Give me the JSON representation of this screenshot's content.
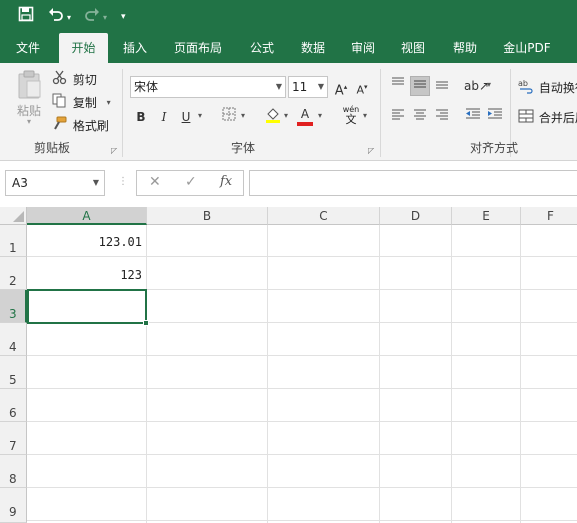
{
  "qat": {
    "save_icon": "save-icon",
    "undo_icon": "undo-icon",
    "redo_icon": "redo-icon",
    "customize_icon": "customize-qat-icon"
  },
  "tabs": [
    {
      "label": "文件"
    },
    {
      "label": "开始"
    },
    {
      "label": "插入"
    },
    {
      "label": "页面布局"
    },
    {
      "label": "公式"
    },
    {
      "label": "数据"
    },
    {
      "label": "审阅"
    },
    {
      "label": "视图"
    },
    {
      "label": "帮助"
    },
    {
      "label": "金山PDF"
    }
  ],
  "ribbon": {
    "clipboard": {
      "paste_label": "粘贴",
      "cut_label": "剪切",
      "copy_label": "复制",
      "format_painter_label": "格式刷",
      "group_label": "剪贴板"
    },
    "font": {
      "font_name": "宋体",
      "font_size": "11",
      "grow_label": "A",
      "shrink_label": "A",
      "bold_label": "B",
      "italic_label": "I",
      "underline_label": "U",
      "font_color_label": "A",
      "phonetic_label": "wén",
      "phonetic_sub": "文",
      "group_label": "字体"
    },
    "alignment": {
      "wrap_text_label": "自动换行",
      "merge_label": "合并后居中",
      "group_label": "对齐方式"
    }
  },
  "formula_bar": {
    "name_box": "A3",
    "fx_label": "fx",
    "cancel_icon": "✕",
    "enter_icon": "✓",
    "formula": ""
  },
  "grid": {
    "columns": [
      "A",
      "B",
      "C",
      "D",
      "E",
      "F"
    ],
    "rows": [
      "1",
      "2",
      "3",
      "4",
      "5",
      "6",
      "7",
      "8",
      "9"
    ],
    "cells": {
      "A1": "123.01",
      "A2": "123"
    },
    "selected_cell": "A3"
  },
  "colors": {
    "accent": "#217346",
    "ribbon_bg": "#f3f3f3"
  }
}
